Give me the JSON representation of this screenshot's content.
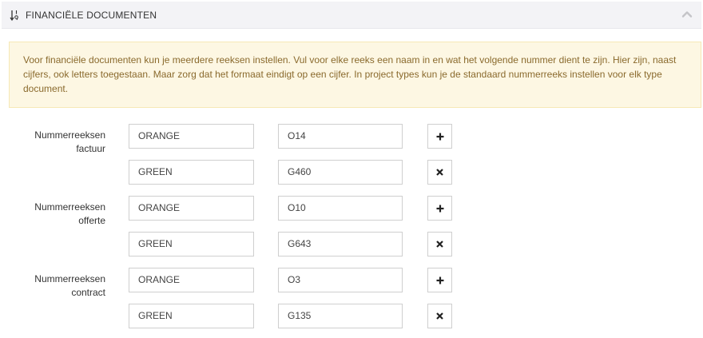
{
  "panel": {
    "title": "FINANCIËLE DOCUMENTEN",
    "icons": {
      "sort": "sort-numeric-icon",
      "collapse": "chevron-up-icon"
    }
  },
  "notice": {
    "text": "Voor financiële documenten kun je meerdere reeksen instellen. Vul voor elke reeks een naam in en wat het volgende nummer dient te zijn. Hier zijn, naast cijfers, ook letters toegestaan. Maar zorg dat het formaat eindigt op een cijfer. In project types kun je de standaard nummerreeks instellen voor elk type document."
  },
  "groups": [
    {
      "label_line1": "Nummerreeksen",
      "label_line2": "factuur",
      "rows": [
        {
          "name": "ORANGE",
          "next": "O14",
          "action": "add"
        },
        {
          "name": "GREEN",
          "next": "G460",
          "action": "remove"
        }
      ]
    },
    {
      "label_line1": "Nummerreeksen",
      "label_line2": "offerte",
      "rows": [
        {
          "name": "ORANGE",
          "next": "O10",
          "action": "add"
        },
        {
          "name": "GREEN",
          "next": "G643",
          "action": "remove"
        }
      ]
    },
    {
      "label_line1": "Nummerreeksen",
      "label_line2": "contract",
      "rows": [
        {
          "name": "ORANGE",
          "next": "O3",
          "action": "add"
        },
        {
          "name": "GREEN",
          "next": "G135",
          "action": "remove"
        }
      ]
    }
  ]
}
